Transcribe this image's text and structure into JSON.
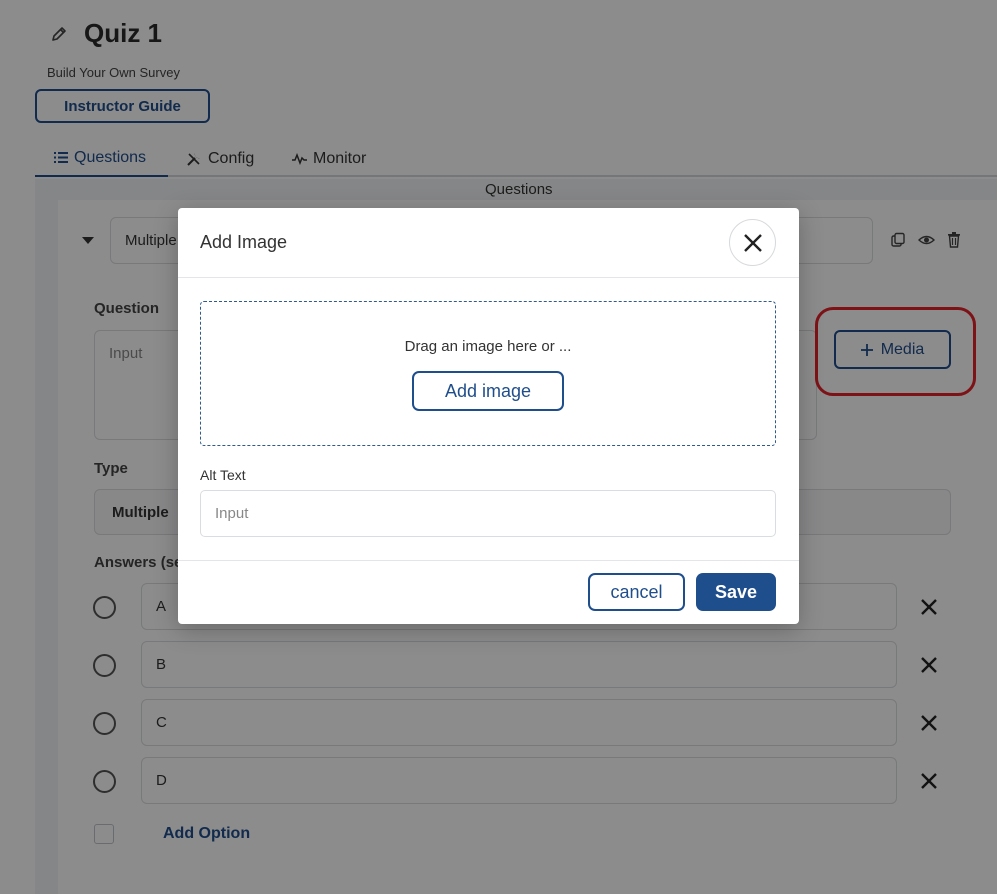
{
  "header": {
    "title": "Quiz 1",
    "subtitle": "Build Your Own Survey",
    "guide_button": "Instructor Guide"
  },
  "tabs": [
    {
      "label": "Questions",
      "icon": "list-icon",
      "active": true
    },
    {
      "label": "Config",
      "icon": "tools-icon",
      "active": false
    },
    {
      "label": "Monitor",
      "icon": "pulse-icon",
      "active": false
    }
  ],
  "section_title": "Questions",
  "question_card": {
    "type_header": "Multiple",
    "question_label": "Question",
    "question_placeholder": "Input",
    "media_button": "Media",
    "type_label": "Type",
    "type_value": "Multiple",
    "answers_label": "Answers (se",
    "answers": [
      "A",
      "B",
      "C",
      "D"
    ],
    "add_option": "Add Option"
  },
  "modal": {
    "title": "Add Image",
    "drop_text": "Drag an image here or ...",
    "add_image_button": "Add image",
    "alt_label": "Alt Text",
    "alt_placeholder": "Input",
    "cancel_button": "cancel",
    "save_button": "Save"
  },
  "colors": {
    "accent": "#1f4e8c",
    "highlight": "#e3232b",
    "overlay": "rgba(0,0,0,0.45)"
  }
}
